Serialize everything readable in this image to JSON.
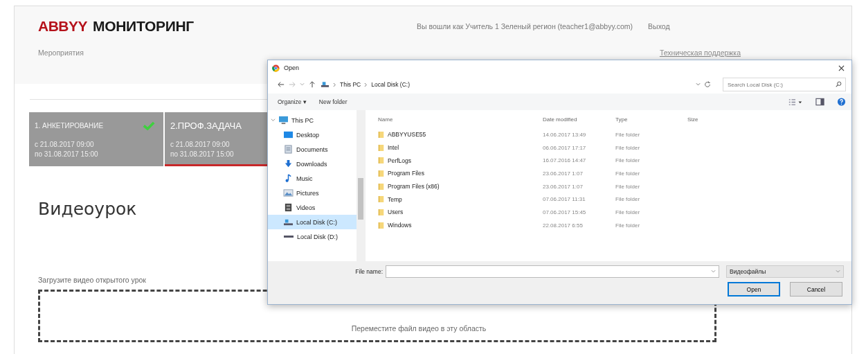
{
  "header": {
    "logo_brand": "ABBYY",
    "logo_product": "МОНИТОРИНГ",
    "user": "Вы вошли как Учитель 1 Зеленый регион (teacher1@abbyy.com)",
    "logout": "Выход"
  },
  "nav": {
    "events": "Мероприятия",
    "support": "Техническая поддержка"
  },
  "stages": [
    {
      "title": "1. АНКЕТИРОВАНИЕ",
      "from": "с 21.08.2017 09:00",
      "to": "по 31.08.2017 15:00",
      "completed": true,
      "selected": false
    },
    {
      "title": "2.ПРОФ.ЗАДАЧА",
      "from": "с 21.08.2017 09:00",
      "to": "по 31.08.2017 15:00",
      "completed": false,
      "selected": true
    }
  ],
  "section_title": "Видеоурок",
  "upload": {
    "label": "Загрузите видео открытого урок",
    "dropzone": "Переместите файл видео в эту область"
  },
  "dialog": {
    "title": "Open",
    "breadcrumb": [
      "This PC",
      "Local Disk (C:)"
    ],
    "search": {
      "placeholder": "Search Local Disk (C:)"
    },
    "toolbar": [
      "Organize ▾",
      "New folder"
    ],
    "tree": [
      {
        "label": "This PC",
        "kind": "pc",
        "selected": false,
        "expanded": true,
        "children": [
          {
            "label": "Desktop",
            "kind": "desktop",
            "selected": false
          },
          {
            "label": "Documents",
            "kind": "documents",
            "selected": false
          },
          {
            "label": "Downloads",
            "kind": "downloads",
            "selected": false
          },
          {
            "label": "Music",
            "kind": "music",
            "selected": false
          },
          {
            "label": "Pictures",
            "kind": "pictures",
            "selected": false
          },
          {
            "label": "Videos",
            "kind": "videos",
            "selected": false
          },
          {
            "label": "Local Disk (C:)",
            "kind": "disk_c",
            "selected": true
          },
          {
            "label": "Local Disk (D:)",
            "kind": "disk_d",
            "selected": false
          }
        ]
      }
    ],
    "columns": [
      "Name",
      "Date modified",
      "Type",
      "Size"
    ],
    "files": [
      {
        "name": "ABBYYUSE55",
        "date": "14.06.2017 13:49",
        "type": "File folder"
      },
      {
        "name": "Intel",
        "date": "06.06.2017 17:17",
        "type": "File folder"
      },
      {
        "name": "PerfLogs",
        "date": "16.07.2016 14:47",
        "type": "File folder"
      },
      {
        "name": "Program Files",
        "date": "23.06.2017 1:07",
        "type": "File folder"
      },
      {
        "name": "Program Files (x86)",
        "date": "23.06.2017 1:07",
        "type": "File folder"
      },
      {
        "name": "Temp",
        "date": "07.06.2017 11:31",
        "type": "File folder"
      },
      {
        "name": "Users",
        "date": "07.06.2017 15:45",
        "type": "File folder"
      },
      {
        "name": "Windows",
        "date": "22.08.2017 6:55",
        "type": "File folder"
      }
    ],
    "file_name_label": "File name:",
    "filter": "Видеофайлы",
    "buttons": [
      "Open",
      "Cancel"
    ]
  }
}
